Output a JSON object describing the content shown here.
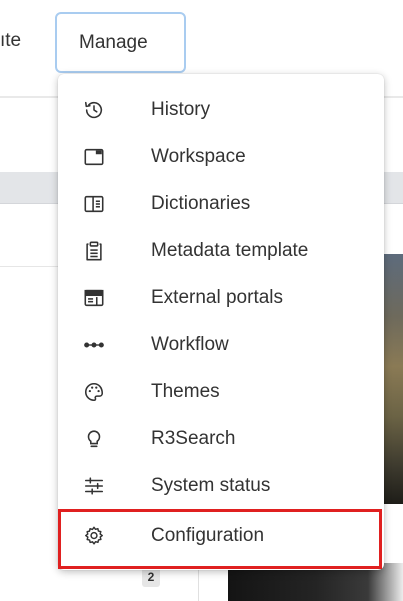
{
  "nav": {
    "prev_tab_fragment": "ıte",
    "manage_label": "Manage"
  },
  "menu": {
    "items": [
      {
        "label": "History",
        "icon": "history-icon"
      },
      {
        "label": "Workspace",
        "icon": "workspace-icon"
      },
      {
        "label": "Dictionaries",
        "icon": "dictionaries-icon"
      },
      {
        "label": "Metadata template",
        "icon": "metadata-template-icon"
      },
      {
        "label": "External portals",
        "icon": "external-portals-icon"
      },
      {
        "label": "Workflow",
        "icon": "workflow-icon"
      },
      {
        "label": "Themes",
        "icon": "themes-icon"
      },
      {
        "label": "R3Search",
        "icon": "r3search-icon"
      },
      {
        "label": "System status",
        "icon": "system-status-icon"
      },
      {
        "label": "Configuration",
        "icon": "configuration-icon"
      }
    ],
    "highlighted_item": "Configuration",
    "highlight_color": "#e02020"
  },
  "background": {
    "badge_count": "2"
  }
}
